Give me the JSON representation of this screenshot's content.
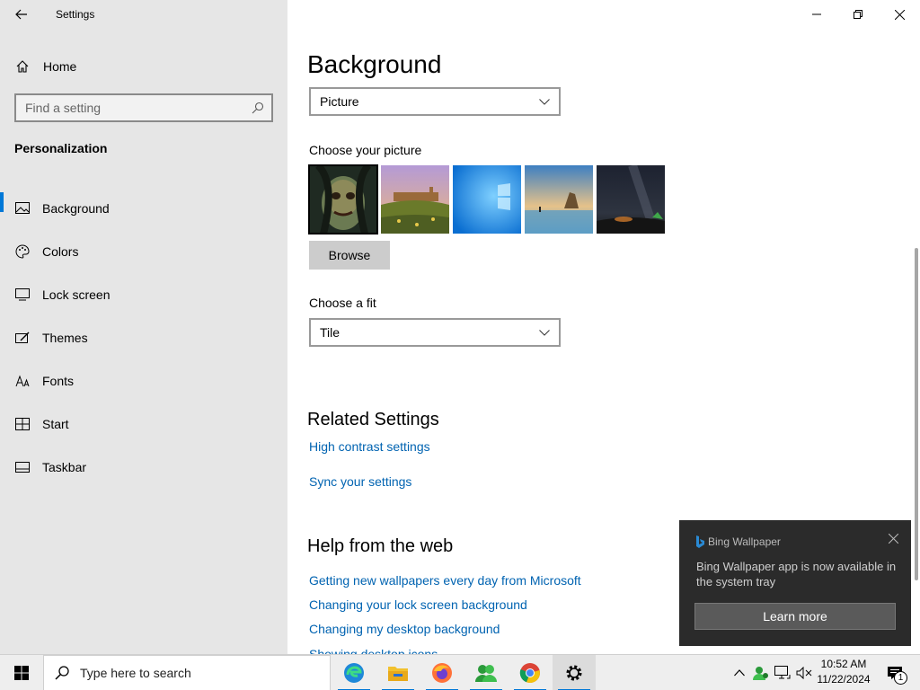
{
  "window": {
    "title": "Settings"
  },
  "sidebar": {
    "home_label": "Home",
    "search_placeholder": "Find a setting",
    "section_label": "Personalization",
    "items": [
      {
        "label": "Background",
        "icon": "background-icon",
        "active": true
      },
      {
        "label": "Colors",
        "icon": "palette-icon",
        "active": false
      },
      {
        "label": "Lock screen",
        "icon": "lock-screen-icon",
        "active": false
      },
      {
        "label": "Themes",
        "icon": "themes-icon",
        "active": false
      },
      {
        "label": "Fonts",
        "icon": "fonts-icon",
        "active": false
      },
      {
        "label": "Start",
        "icon": "start-icon",
        "active": false
      },
      {
        "label": "Taskbar",
        "icon": "taskbar-icon",
        "active": false
      }
    ]
  },
  "main": {
    "title": "Background",
    "background_value": "Picture",
    "choose_picture_label": "Choose your picture",
    "browse_label": "Browse",
    "choose_fit_label": "Choose a fit",
    "fit_value": "Tile",
    "related_heading": "Related Settings",
    "related_links": [
      "High contrast settings",
      "Sync your settings"
    ],
    "help_heading": "Help from the web",
    "help_links": [
      "Getting new wallpapers every day from Microsoft",
      "Changing your lock screen background",
      "Changing my desktop background",
      "Showing desktop icons"
    ]
  },
  "toast": {
    "app_name": "Bing Wallpaper",
    "message": "Bing Wallpaper app is now available in the system tray",
    "button_label": "Learn more"
  },
  "taskbar": {
    "search_placeholder": "Type here to search",
    "time": "10:52 AM",
    "date": "11/22/2024",
    "notification_count": "1"
  },
  "colors": {
    "accent": "#0078d7",
    "link": "#0063b1",
    "sidebar_bg": "#e6e6e6",
    "toast_bg": "#2b2b2b"
  }
}
